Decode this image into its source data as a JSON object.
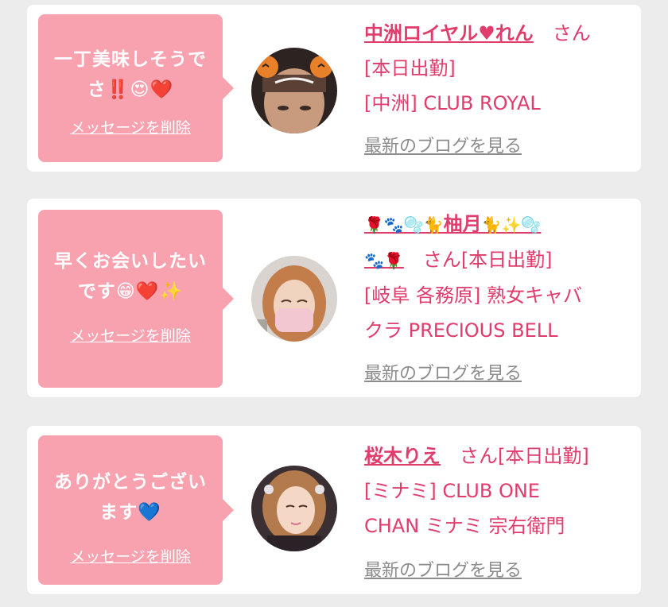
{
  "cards": [
    {
      "message_line1": "一丁美味しそうで",
      "message_line2": "さ‼️😍❤️",
      "delete_label": "メッセージを削除",
      "cast_name": "中洲ロイヤル♥れん",
      "honorific": "さん",
      "status": "[本日出勤]",
      "venue_line1": "[中洲] CLUB ROYAL",
      "blog_label": "最新のブログを見る",
      "avatar_icon": "halloween-pumpkin-ears-photo"
    },
    {
      "message_line1": "早くお会いしたい",
      "message_line2": "です😁❤️✨",
      "delete_label": "メッセージを削除",
      "name_prefix": "🌹🐾🫧🐈",
      "cast_name": "柚月",
      "name_suffix": "🐈✨🫧",
      "name_line2": "🐾🌹",
      "honorific": "さん",
      "status": "[本日出勤]",
      "venue_line1": "[岐阜 各務原] 熟女キャバ",
      "venue_line2": "クラ PRECIOUS BELL",
      "blog_label": "最新のブログを見る",
      "avatar_icon": "masked-woman-photo"
    },
    {
      "message_line1": "ありがとうござい",
      "message_line2": "ます💙",
      "delete_label": "メッセージを削除",
      "cast_name": "桜木りえ",
      "honorific": "さん",
      "status": "[本日出勤]",
      "venue_line1": "[ミナミ] CLUB ONE",
      "venue_line2": "CHAN ミナミ 宗右衛門",
      "blog_label": "最新のブログを見る",
      "avatar_icon": "woman-portrait-photo"
    }
  ],
  "colors": {
    "accent_pink": "#e03c6c",
    "bubble_pink": "#f8a1af",
    "link_gray": "#8c8c8c",
    "background": "#ececec"
  }
}
